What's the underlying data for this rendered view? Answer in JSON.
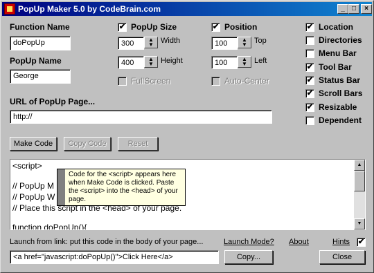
{
  "window": {
    "title": "PopUp Maker 5.0 by CodeBrain.com",
    "controls": {
      "minimize": "_",
      "maximize": "□",
      "close": "×"
    }
  },
  "function_name": {
    "label": "Function Name",
    "value": "doPopUp"
  },
  "popup_name": {
    "label": "PopUp Name",
    "value": "George"
  },
  "popup_size": {
    "label": "PopUp Size",
    "checked": true,
    "width_value": "300",
    "width_label": "Width",
    "height_value": "400",
    "height_label": "Height",
    "fullscreen_label": "FullScreen"
  },
  "position": {
    "label": "Position",
    "checked": true,
    "top_value": "100",
    "top_label": "Top",
    "left_value": "100",
    "left_label": "Left",
    "autocenter_label": "Auto-Center"
  },
  "features": [
    {
      "label": "Location",
      "checked": true
    },
    {
      "label": "Directories",
      "checked": false
    },
    {
      "label": "Menu Bar",
      "checked": false
    },
    {
      "label": "Tool Bar",
      "checked": true
    },
    {
      "label": "Status Bar",
      "checked": true
    },
    {
      "label": "Scroll Bars",
      "checked": true
    },
    {
      "label": "Resizable",
      "checked": true
    },
    {
      "label": "Dependent",
      "checked": false
    }
  ],
  "url": {
    "label": "URL of PopUp Page...",
    "value": "http://"
  },
  "buttons": {
    "make_code": "Make Code",
    "copy_code": "Copy Code",
    "reset": "Reset",
    "copy": "Copy...",
    "close": "Close"
  },
  "code": {
    "lines": [
      "<script>",
      "",
      "// PopUp M",
      "// PopUp W",
      "// Place this script in the <head> of your page.",
      "",
      "function doPopUp(){"
    ]
  },
  "tooltip": {
    "text": "Code for the <script> appears here when Make Code is clicked.  Paste the <script> into the <head> of your page."
  },
  "launch": {
    "label": "Launch from link: put this code in the body of your page...",
    "value": "<a href=\"javascript:doPopUp()\">Click Here</a>"
  },
  "links": {
    "launch_mode": "Launch Mode?",
    "about": "About",
    "hints": "Hints"
  },
  "check_mark": "✔"
}
